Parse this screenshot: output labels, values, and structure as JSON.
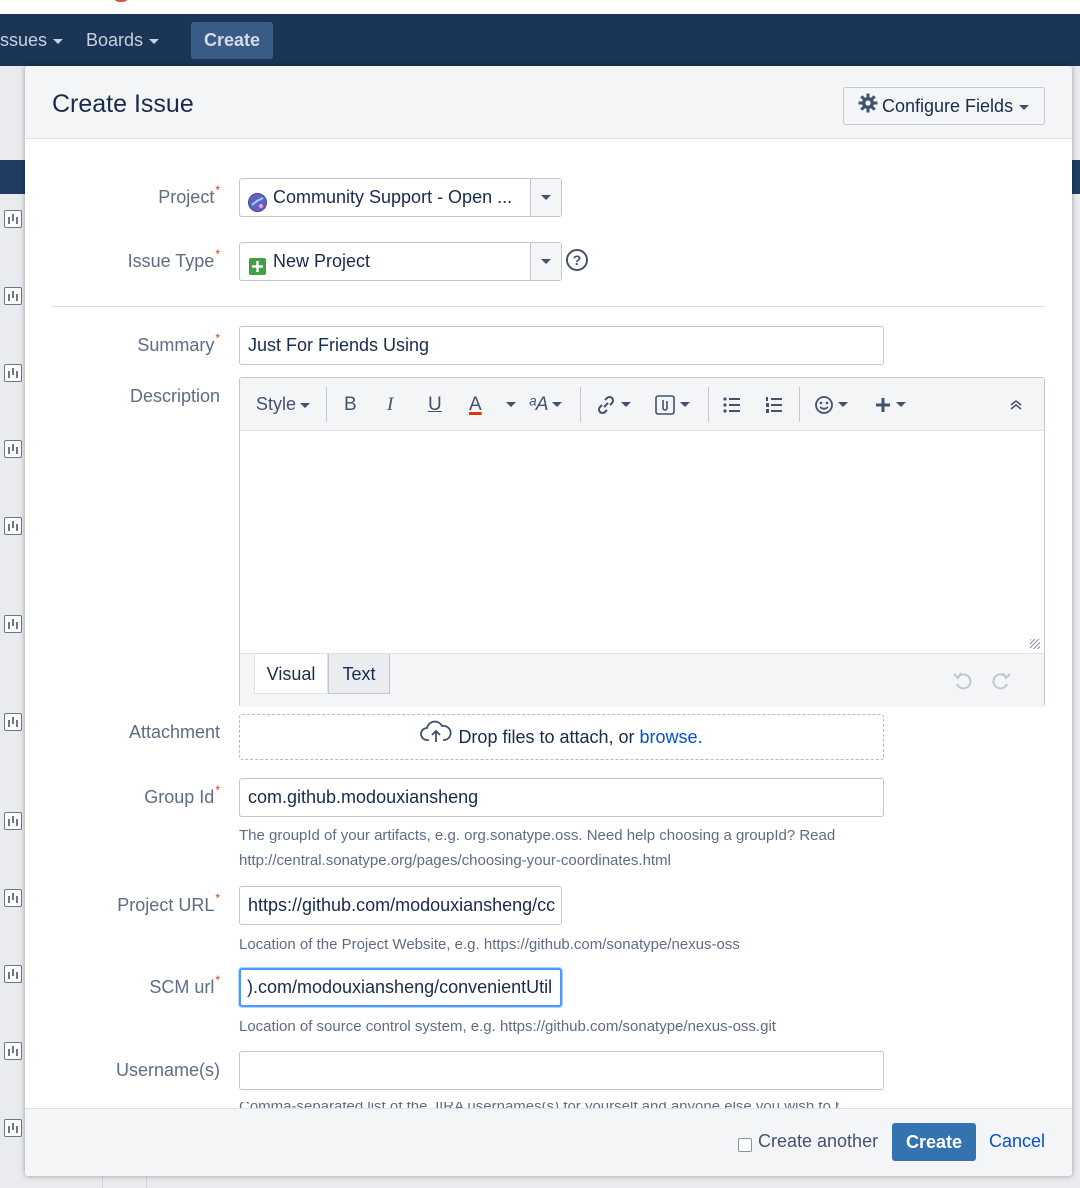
{
  "nav": {
    "issues_label": "ssues",
    "boards_label": "Boards",
    "create_label": "Create"
  },
  "dialog": {
    "title": "Create Issue",
    "configure_fields_label": "Configure Fields"
  },
  "form": {
    "required_marker": "*",
    "project": {
      "label": "Project",
      "value": "Community Support - Open ..."
    },
    "issue_type": {
      "label": "Issue Type",
      "value": "New Project",
      "help_glyph": "?"
    },
    "summary": {
      "label": "Summary",
      "value": "Just For Friends Using"
    },
    "description": {
      "label": "Description",
      "toolbar": {
        "style_label": "Style",
        "bold": "B",
        "italic": "I",
        "underline": "U",
        "text_color": "A",
        "font_size": "ᵃA"
      },
      "tabs": {
        "visual": "Visual",
        "text": "Text"
      }
    },
    "attachment": {
      "label": "Attachment",
      "drop_text": "Drop files to attach, or ",
      "browse_link": "browse."
    },
    "group_id": {
      "label": "Group Id",
      "value": "com.github.modouxiansheng",
      "hint_line1": "The groupId of your artifacts, e.g. org.sonatype.oss. Need help choosing a groupId? Read",
      "hint_line2": "http://central.sonatype.org/pages/choosing-your-coordinates.html"
    },
    "project_url": {
      "label": "Project URL",
      "value": "https://github.com/modouxiansheng/cc",
      "hint": "Location of the Project Website, e.g. https://github.com/sonatype/nexus-oss"
    },
    "scm_url": {
      "label": "SCM url",
      "value": ").com/modouxiansheng/convenientUtil",
      "hint": "Location of source control system, e.g. https://github.com/sonatype/nexus-oss.git"
    },
    "usernames": {
      "label": "Username(s)",
      "value": "",
      "hint_cut": "Comma-separated list of the JIRA usernames(s) for yourself and anyone else you wish to be able to deploy artifacts to"
    }
  },
  "footer": {
    "create_another_label": "Create another",
    "create_label": "Create",
    "cancel_label": "Cancel"
  },
  "colors": {
    "navbar": "#1b3556",
    "primary_button": "#3572b0",
    "link": "#0052cc",
    "required": "#de350b",
    "focus_ring": "#4c9aff"
  }
}
